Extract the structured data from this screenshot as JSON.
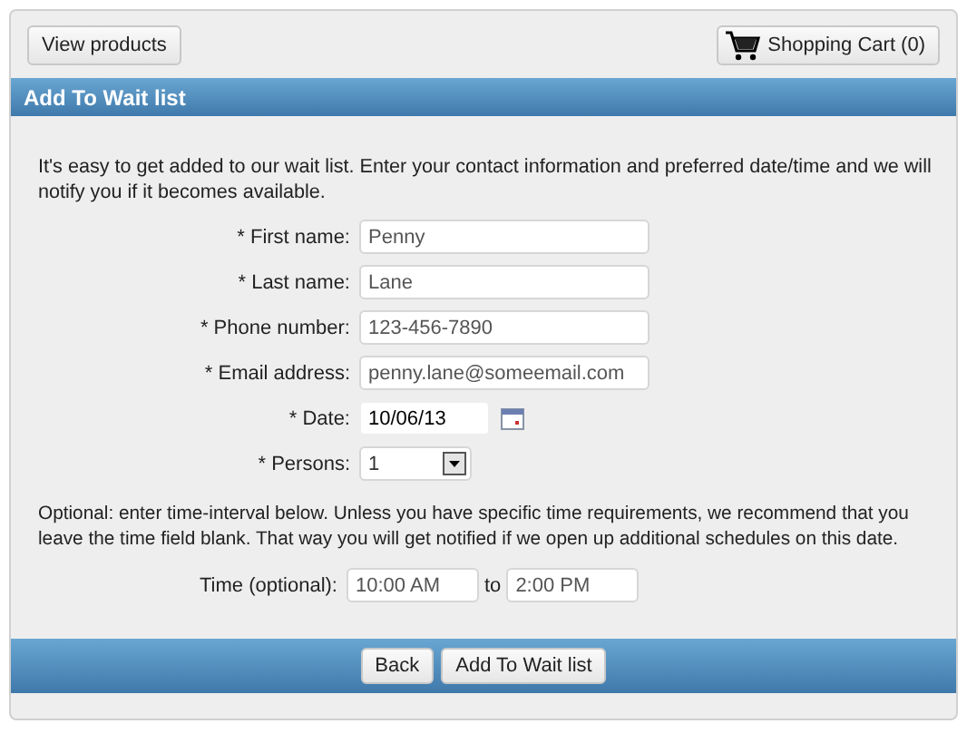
{
  "toolbar": {
    "view_products": "View products",
    "cart": "Shopping Cart (0)"
  },
  "header": {
    "title": "Add To Wait list"
  },
  "intro": "It's easy to get added to our wait list. Enter your contact information and preferred date/time and we will notify you if it becomes available.",
  "fields": [
    {
      "label": "* First name:",
      "value": "Penny",
      "kind": "text"
    },
    {
      "label": "* Last name:",
      "value": "Lane",
      "kind": "text"
    },
    {
      "label": "* Phone number:",
      "value": "123-456-7890",
      "kind": "text"
    },
    {
      "label": "* Email address:",
      "value": "penny.lane@someemail.com",
      "kind": "text"
    },
    {
      "label": "* Date:",
      "value": "10/06/13",
      "kind": "date"
    },
    {
      "label": "* Persons:",
      "value": "1",
      "kind": "select"
    }
  ],
  "optional_note": "Optional: enter time-interval below. Unless you have specific time requirements, we recommend that you leave the time field blank. That way you will get notified if we open up additional schedules on this date.",
  "time": {
    "label": "Time (optional):",
    "from": "10:00 AM",
    "separator": "to",
    "to": "2:00 PM"
  },
  "footer": {
    "buttons": [
      "Back",
      "Add To Wait list"
    ]
  }
}
